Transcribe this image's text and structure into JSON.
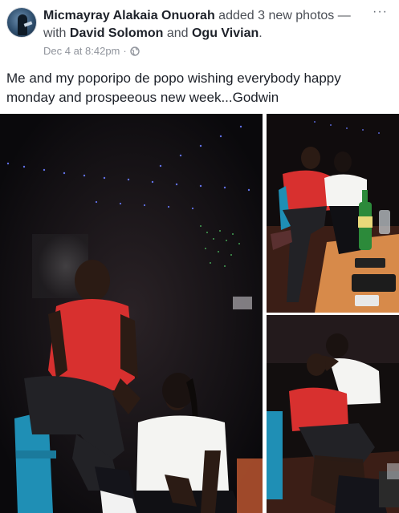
{
  "post": {
    "author": "Micmayray Alakaia Onuorah",
    "action": "added 3 new photos — with",
    "tagged_1": "David Solomon",
    "conjunction": "and",
    "tagged_2": "Ogu Vivian",
    "end_punct": ".",
    "timestamp": "Dec 4 at 8:42pm",
    "separator": "·",
    "privacy_icon": "globe-icon",
    "more_label": "···",
    "caption": "Me and my poporipo de popo wishing everybody happy monday and prospeeous new week...Godwin"
  },
  "photos": [
    {
      "name": "couple-seated-night-photo"
    },
    {
      "name": "couple-table-bottle-photo"
    },
    {
      "name": "couple-hugging-photo"
    }
  ],
  "colors": {
    "text_primary": "#1d2129",
    "text_secondary": "#90949c",
    "shirt_red": "#d8302f",
    "shirt_white": "#f4f4f2"
  }
}
